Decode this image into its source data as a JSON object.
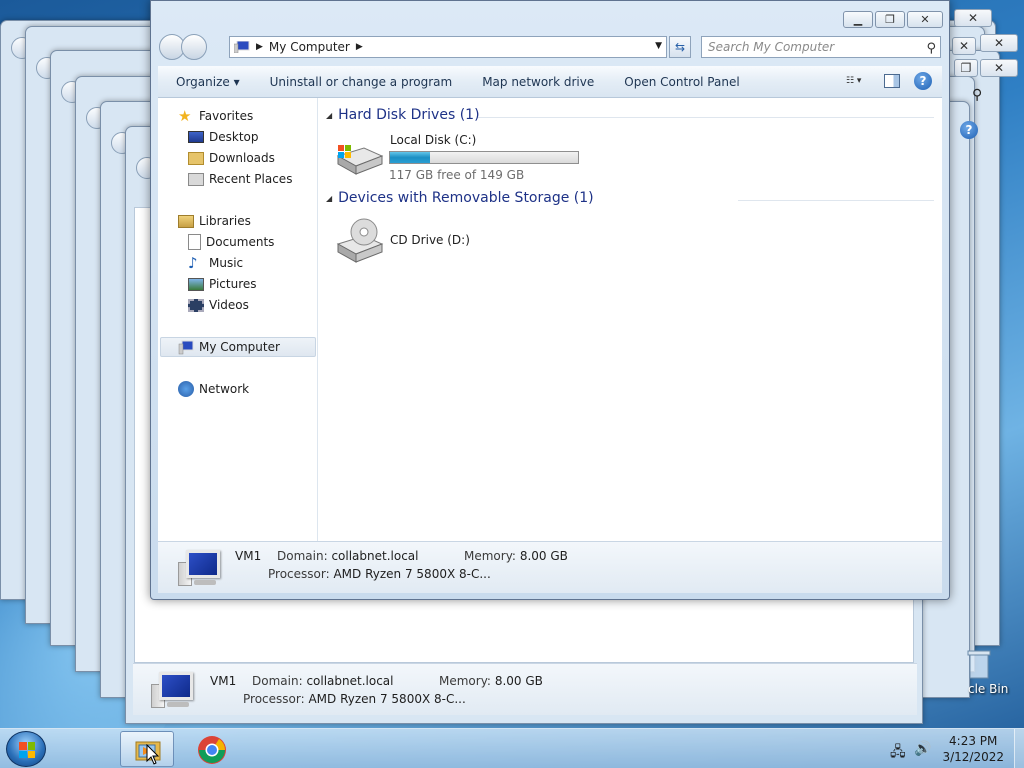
{
  "window": {
    "address": {
      "crumb": "My Computer"
    },
    "search": {
      "placeholder": "Search My Computer"
    },
    "caption": {
      "minimize": "▭",
      "maximize": "❐",
      "close": "✕"
    }
  },
  "toolbar": {
    "organize": "Organize",
    "uninstall": "Uninstall or change a program",
    "map_drive": "Map network drive",
    "control_panel": "Open Control Panel",
    "help": "?"
  },
  "nav": {
    "favorites": "Favorites",
    "desktop": "Desktop",
    "downloads": "Downloads",
    "recent": "Recent Places",
    "libraries": "Libraries",
    "documents": "Documents",
    "music": "Music",
    "pictures": "Pictures",
    "videos": "Videos",
    "computer": "My Computer",
    "network": "Network"
  },
  "groups": {
    "hdd": {
      "title": "Hard Disk Drives (1)",
      "drive_name": "Local Disk (C:)",
      "free_text": "117 GB free of 149 GB",
      "used_fraction": 0.215
    },
    "removable": {
      "title": "Devices with Removable Storage (1)",
      "drive_name": "CD Drive (D:)"
    }
  },
  "details": {
    "name": "VM1",
    "domain_label": "Domain:",
    "domain": "collabnet.local",
    "memory_label": "Memory:",
    "memory": "8.00 GB",
    "processor_label": "Processor:",
    "processor": "AMD Ryzen 7 5800X 8-C..."
  },
  "desktop": {
    "recycle_label": "cle Bin"
  },
  "taskbar": {
    "time": "4:23 PM",
    "date": "3/12/2022"
  }
}
